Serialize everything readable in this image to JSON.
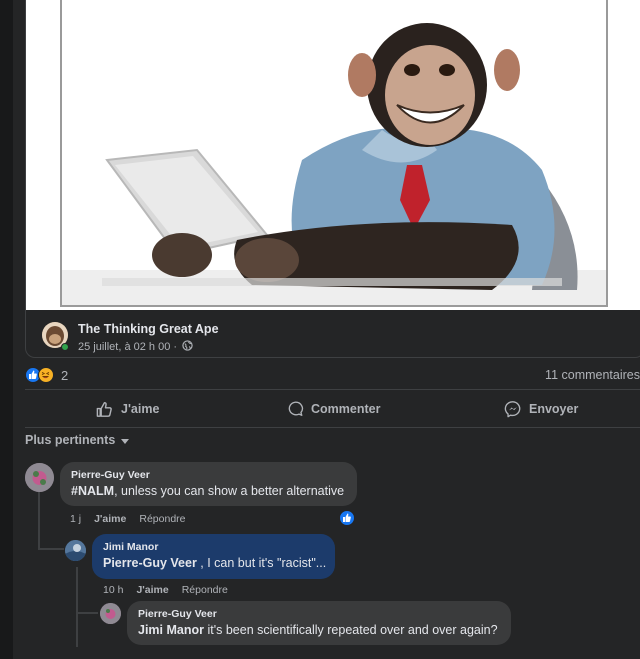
{
  "post": {
    "page_name": "The Thinking Great Ape",
    "post_meta": "25 juillet, à 02 h 00 ·",
    "reaction_count": "2",
    "comments_count": "11 commentaires"
  },
  "actions": {
    "like_label": "J'aime",
    "comment_label": "Commenter",
    "share_label": "Envoyer"
  },
  "sort": {
    "label": "Plus pertinents"
  },
  "comments": [
    {
      "author": "Pierre-Guy Veer",
      "tag": "#NALM",
      "text": ", unless you can show a better alternative",
      "time": "1 j",
      "like": "J'aime",
      "reply": "Répondre"
    },
    {
      "author": "Jimi Manor",
      "tag": "Pierre-Guy Veer",
      "text": " , I can but it's \"racist\"...",
      "time": "10 h",
      "like": "J'aime",
      "reply": "Répondre"
    },
    {
      "author": "Pierre-Guy Veer",
      "tag": "Jimi Manor",
      "text": " it's been scientifically repeated over and over again?"
    }
  ],
  "colors": {
    "background": "#242526",
    "bubble": "#3a3b3c",
    "reply_bubble": "#1c3b6b",
    "like_blue": "#1877f2",
    "secondary_text": "#b0b3b8"
  }
}
